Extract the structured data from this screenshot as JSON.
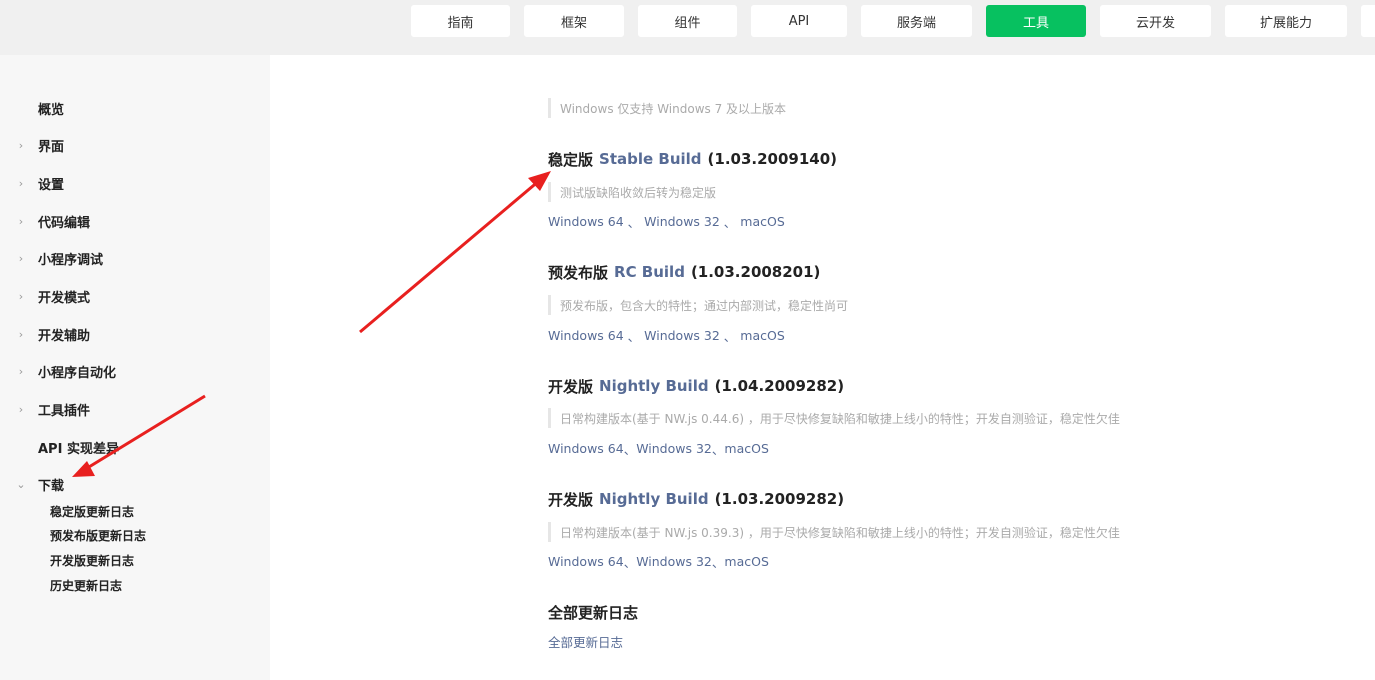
{
  "nav": {
    "tabs": [
      {
        "label": "指南",
        "active": false
      },
      {
        "label": "框架",
        "active": false
      },
      {
        "label": "组件",
        "active": false
      },
      {
        "label": "API",
        "active": false
      },
      {
        "label": "服务端",
        "active": false
      },
      {
        "label": "工具",
        "active": true
      },
      {
        "label": "云开发",
        "active": false
      },
      {
        "label": "扩展能力",
        "active": false
      }
    ],
    "active_color": "#07c160"
  },
  "sidebar": {
    "items": [
      {
        "label": "概览",
        "icon": ""
      },
      {
        "label": "界面",
        "icon": "chevron-right-icon"
      },
      {
        "label": "设置",
        "icon": "chevron-right-icon"
      },
      {
        "label": "代码编辑",
        "icon": "chevron-right-icon"
      },
      {
        "label": "小程序调试",
        "icon": "chevron-right-icon"
      },
      {
        "label": "开发模式",
        "icon": "chevron-right-icon"
      },
      {
        "label": "开发辅助",
        "icon": "chevron-right-icon"
      },
      {
        "label": "小程序自动化",
        "icon": "chevron-right-icon"
      },
      {
        "label": "工具插件",
        "icon": "chevron-right-icon"
      },
      {
        "label": "API 实现差异",
        "icon": ""
      },
      {
        "label": "下载",
        "icon": "chevron-down-icon"
      }
    ],
    "sub_items": [
      {
        "label": "稳定版更新日志"
      },
      {
        "label": "预发布版更新日志"
      },
      {
        "label": "开发版更新日志"
      },
      {
        "label": "历史更新日志"
      }
    ]
  },
  "main": {
    "top_note": "Windows 仅支持 Windows 7 及以上版本",
    "sections": [
      {
        "prefix": "稳定版",
        "build_name": "Stable Build",
        "version": "(1.03.2009140)",
        "note": "测试版缺陷收敛后转为稳定版",
        "links": [
          "Windows 64",
          "Windows 32",
          "macOS"
        ],
        "sep": " 、 "
      },
      {
        "prefix": "预发布版",
        "build_name": "RC Build",
        "version": "(1.03.2008201)",
        "note": "预发布版，包含大的特性；通过内部测试，稳定性尚可",
        "links": [
          "Windows 64",
          "Windows 32",
          "macOS"
        ],
        "sep": " 、 "
      },
      {
        "prefix": "开发版",
        "build_name": "Nightly Build",
        "version": "(1.04.2009282)",
        "note": "日常构建版本(基于 NW.js 0.44.6) ，用于尽快修复缺陷和敏捷上线小的特性；开发自测验证，稳定性欠佳",
        "links": [
          "Windows 64",
          "Windows 32",
          "macOS"
        ],
        "sep": "、"
      },
      {
        "prefix": "开发版",
        "build_name": "Nightly Build",
        "version": "(1.03.2009282)",
        "note": "日常构建版本(基于 NW.js 0.39.3) ，用于尽快修复缺陷和敏捷上线小的特性；开发自测验证，稳定性欠佳",
        "links": [
          "Windows 64",
          "Windows 32",
          "macOS"
        ],
        "sep": "、"
      }
    ],
    "changelog": {
      "title": "全部更新日志",
      "link": "全部更新日志"
    },
    "link_color": "#576b95"
  },
  "annotations": {
    "arrow_color": "#e8201f"
  }
}
